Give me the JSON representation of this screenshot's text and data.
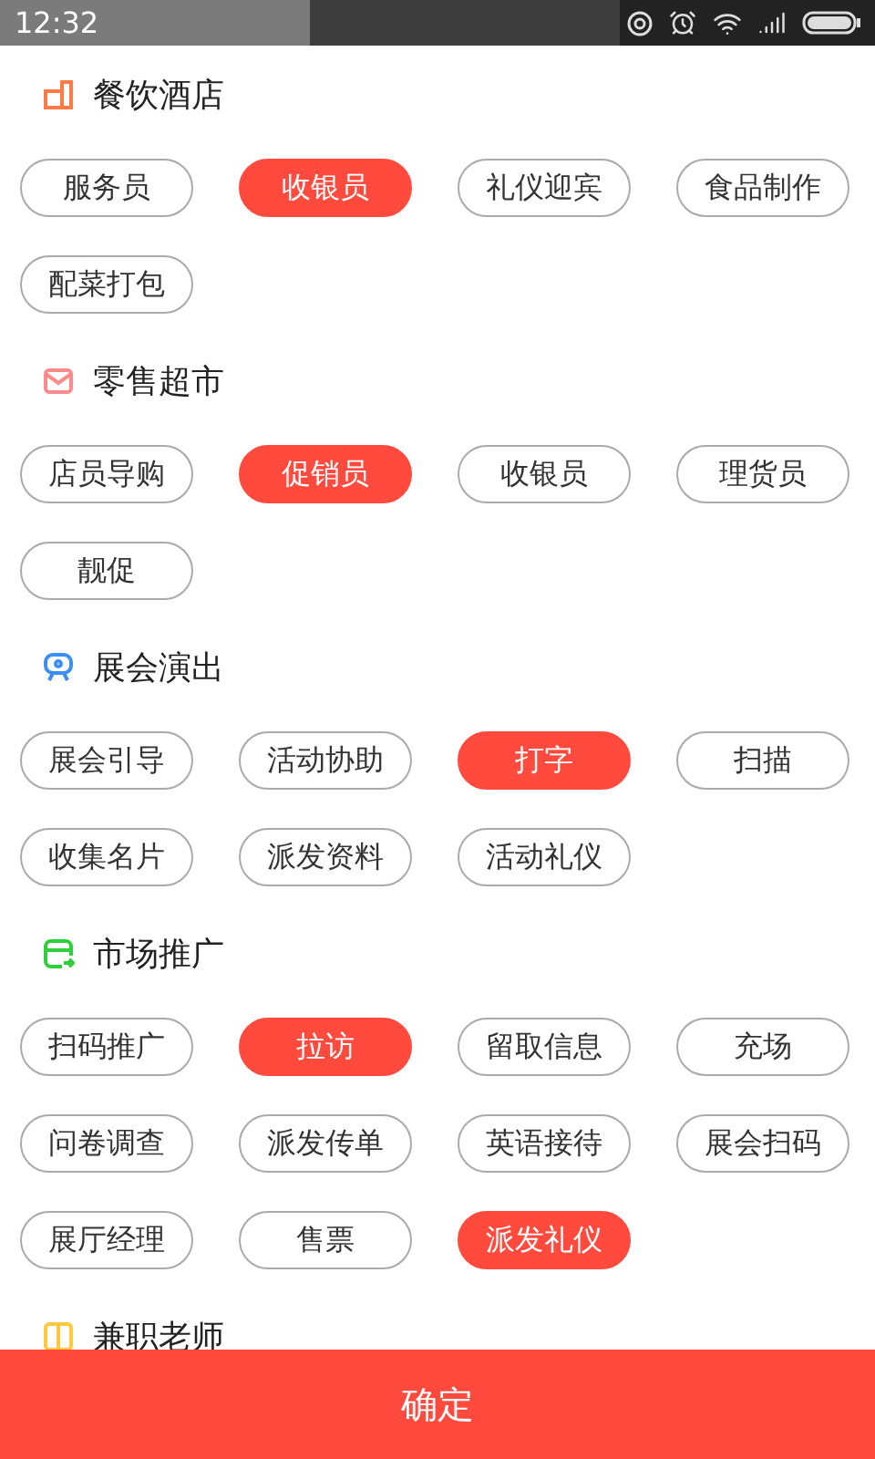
{
  "status_bar": {
    "time": "12:32"
  },
  "sections": [
    {
      "title": "餐饮酒店",
      "kind": "building",
      "color": "#ff7a45",
      "tags": [
        {
          "label": "服务员",
          "selected": false
        },
        {
          "label": "收银员",
          "selected": true
        },
        {
          "label": "礼仪迎宾",
          "selected": false
        },
        {
          "label": "食品制作",
          "selected": false
        },
        {
          "label": "配菜打包",
          "selected": false
        }
      ]
    },
    {
      "title": "零售超市",
      "kind": "bag",
      "color": "#ff8a8a",
      "tags": [
        {
          "label": "店员导购",
          "selected": false
        },
        {
          "label": "促销员",
          "selected": true
        },
        {
          "label": "收银员",
          "selected": false
        },
        {
          "label": "理货员",
          "selected": false
        },
        {
          "label": "靓促",
          "selected": false
        }
      ]
    },
    {
      "title": "展会演出",
      "kind": "booth",
      "color": "#3d8ff5",
      "tags": [
        {
          "label": "展会引导",
          "selected": false
        },
        {
          "label": "活动协助",
          "selected": false
        },
        {
          "label": "打字",
          "selected": true
        },
        {
          "label": "扫描",
          "selected": false
        },
        {
          "label": "收集名片",
          "selected": false
        },
        {
          "label": "派发资料",
          "selected": false
        },
        {
          "label": "活动礼仪",
          "selected": false
        }
      ]
    },
    {
      "title": "市场推广",
      "kind": "card",
      "color": "#2fcf3a",
      "tags": [
        {
          "label": "扫码推广",
          "selected": false
        },
        {
          "label": "拉访",
          "selected": true
        },
        {
          "label": "留取信息",
          "selected": false
        },
        {
          "label": "充场",
          "selected": false
        },
        {
          "label": "问卷调查",
          "selected": false
        },
        {
          "label": "派发传单",
          "selected": false
        },
        {
          "label": "英语接待",
          "selected": false
        },
        {
          "label": "展会扫码",
          "selected": false
        },
        {
          "label": "展厅经理",
          "selected": false
        },
        {
          "label": "售票",
          "selected": false
        },
        {
          "label": "派发礼仪",
          "selected": true
        }
      ]
    },
    {
      "title": "兼职老师",
      "kind": "book",
      "color": "#ffc83d"
    }
  ],
  "confirm_button": "确定"
}
